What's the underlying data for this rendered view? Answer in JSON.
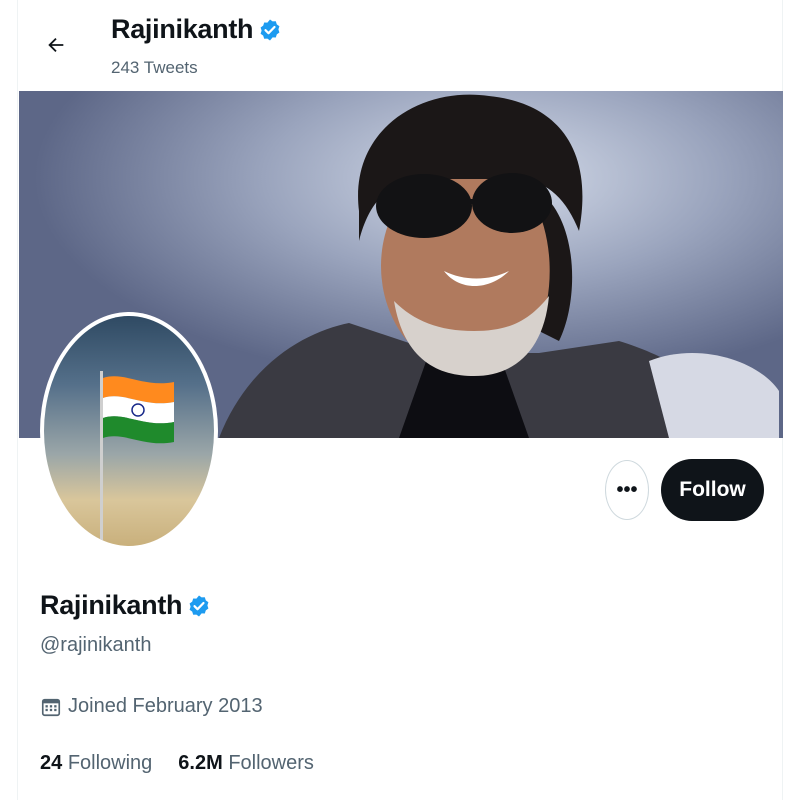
{
  "header": {
    "name": "Rajinikanth",
    "tweet_count": "243 Tweets"
  },
  "profile": {
    "name": "Rajinikanth",
    "handle": "@rajinikanth",
    "joined": "Joined February 2013",
    "following_count": "24",
    "following_label": "Following",
    "followers_count": "6.2M",
    "followers_label": "Followers"
  },
  "actions": {
    "more_label": "•••",
    "follow_label": "Follow"
  },
  "icons": {
    "back": "arrow-left-icon",
    "verified": "verified-badge-icon",
    "calendar": "calendar-icon",
    "more": "more-icon"
  },
  "colors": {
    "verified": "#1d9bf0",
    "follow_bg": "#0f1419",
    "secondary_text": "#536471"
  }
}
